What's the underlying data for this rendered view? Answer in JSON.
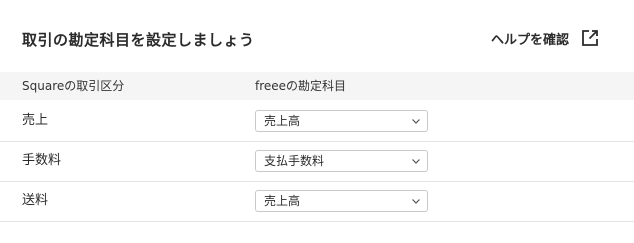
{
  "header": {
    "title": "取引の勘定科目を設定しましょう",
    "help_label": "ヘルプを確認",
    "help_icon": "external-link-icon"
  },
  "table": {
    "columns": [
      "Squareの取引区分",
      "freeeの勘定科目"
    ],
    "rows": [
      {
        "category": "売上",
        "account": "売上高"
      },
      {
        "category": "手数料",
        "account": "支払手数料"
      },
      {
        "category": "送料",
        "account": "売上高"
      }
    ]
  },
  "colors": {
    "header_bg": "#f5f5f5",
    "border": "#c9c9c9",
    "divider": "#e3e3e3",
    "text": "#2b2b2b"
  }
}
